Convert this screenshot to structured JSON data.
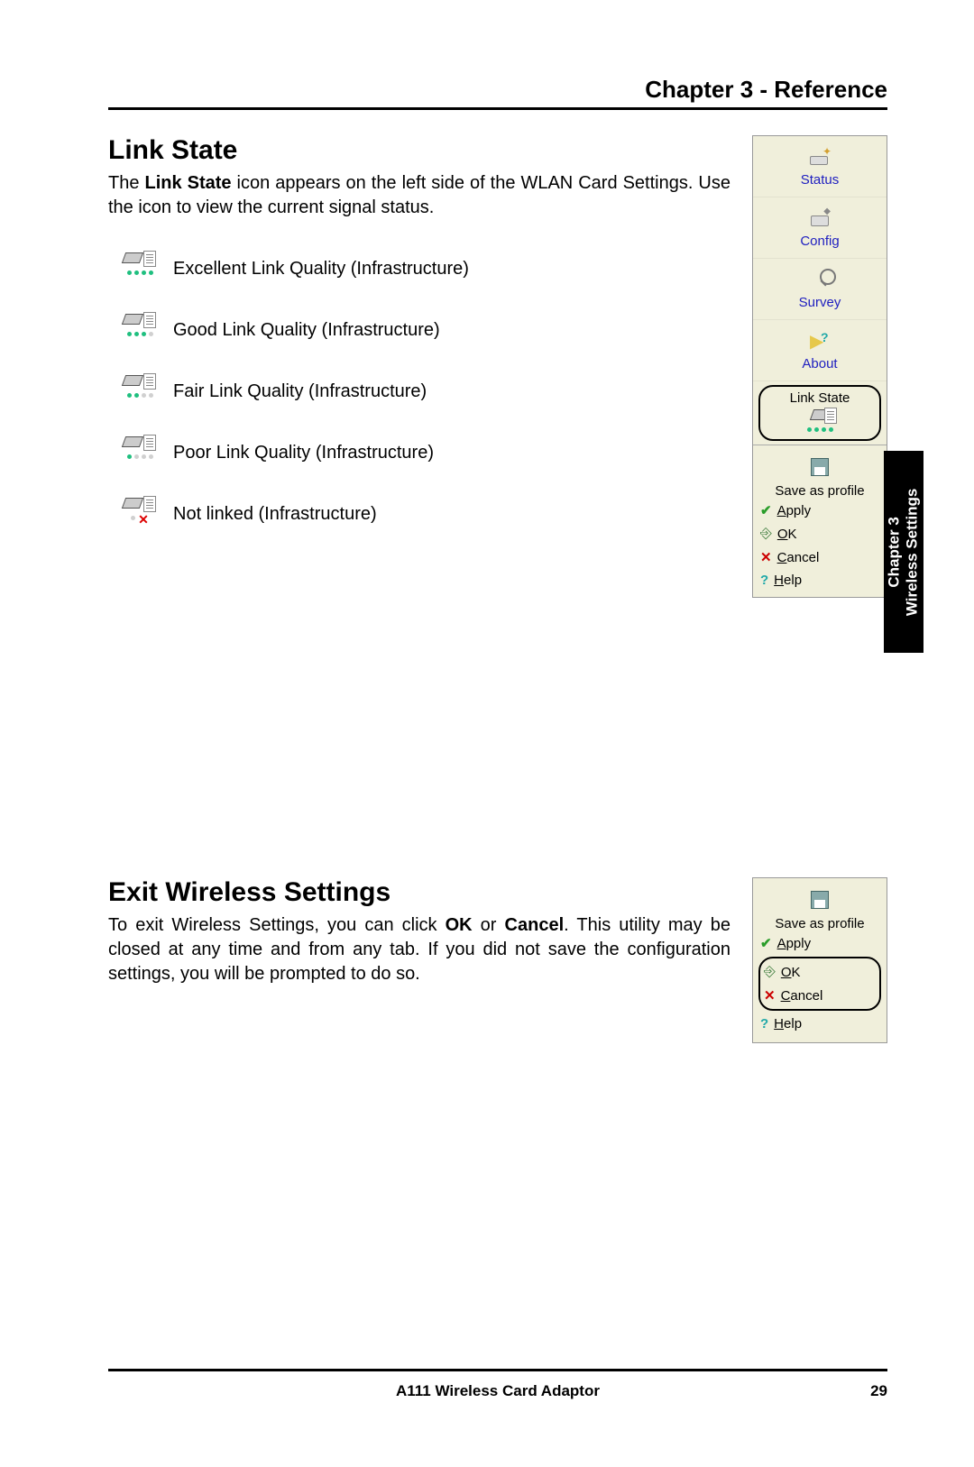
{
  "header": {
    "chapter": "Chapter 3 - Reference"
  },
  "link_state": {
    "title": "Link State",
    "intro_pre": "The ",
    "intro_bold": "Link State",
    "intro_post": " icon appears on the left side of the WLAN Card Settings. Use the icon to view the current signal status.",
    "items": [
      {
        "label": "Excellent Link Quality (Infrastructure)",
        "dots": 4
      },
      {
        "label": "Good Link Quality (Infrastructure)",
        "dots": 3
      },
      {
        "label": "Fair Link Quality (Infrastructure)",
        "dots": 2
      },
      {
        "label": "Poor Link Quality (Infrastructure)",
        "dots": 1
      },
      {
        "label": "Not linked (Infrastructure)",
        "dots": 0
      }
    ]
  },
  "sidebar": {
    "status": "Status",
    "config": "Config",
    "survey": "Survey",
    "about": "About",
    "link_state": "Link State",
    "save_as_profile": "Save as profile",
    "apply": "Apply",
    "apply_u": "A",
    "ok": "OK",
    "ok_u": "O",
    "cancel": "Cancel",
    "cancel_u": "C",
    "help": "Help",
    "help_u": "H"
  },
  "side_tab": {
    "line1": "Chapter 3",
    "line2": "Wireless Settings"
  },
  "exit": {
    "title": "Exit Wireless Settings",
    "text_pre": "To exit Wireless Settings, you can click ",
    "text_b1": "OK",
    "text_mid": " or ",
    "text_b2": "Cancel",
    "text_post": ". This utility may be closed at any time and from any tab. If you did not save the configuration settings, you will be prompted to do so."
  },
  "footer": {
    "product": "A111 Wireless Card Adaptor",
    "page": "29"
  }
}
